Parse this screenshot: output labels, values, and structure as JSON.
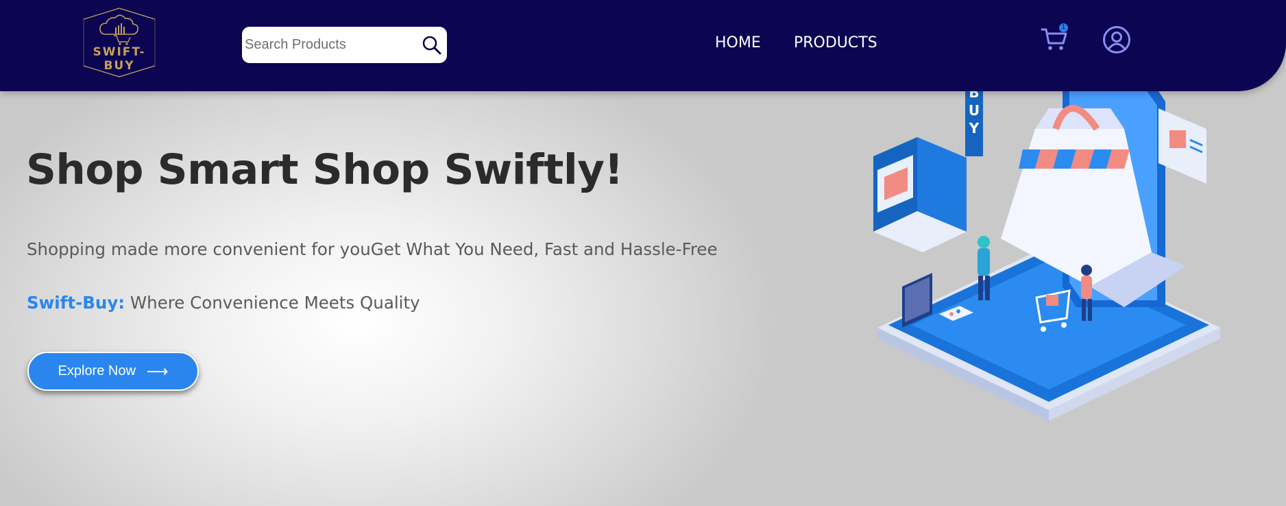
{
  "header": {
    "logo_text": "SWIFT-BUY",
    "search": {
      "placeholder": "Search Products",
      "value": ""
    },
    "nav": [
      {
        "label": "HOME"
      },
      {
        "label": "PRODUCTS"
      }
    ],
    "cart": {
      "count": "1",
      "icon": "cart-icon"
    },
    "user": {
      "icon": "user-circle-icon"
    }
  },
  "hero": {
    "title": "Shop Smart Shop Swiftly!",
    "description": "Shopping made more convenient for youGet What You Need, Fast and Hassle-Free",
    "brand_name": "Swift-Buy:",
    "tagline": " Where Convenience Meets Quality",
    "cta_label": "Explore Now",
    "cta_arrow": "⟶",
    "illustration_sign": "BUY"
  },
  "colors": {
    "header_bg": "#0b0552",
    "accent": "#2a86ee",
    "logo_gold": "#c4a15d",
    "title": "#2b2b2b",
    "text": "#5a5a5a"
  }
}
